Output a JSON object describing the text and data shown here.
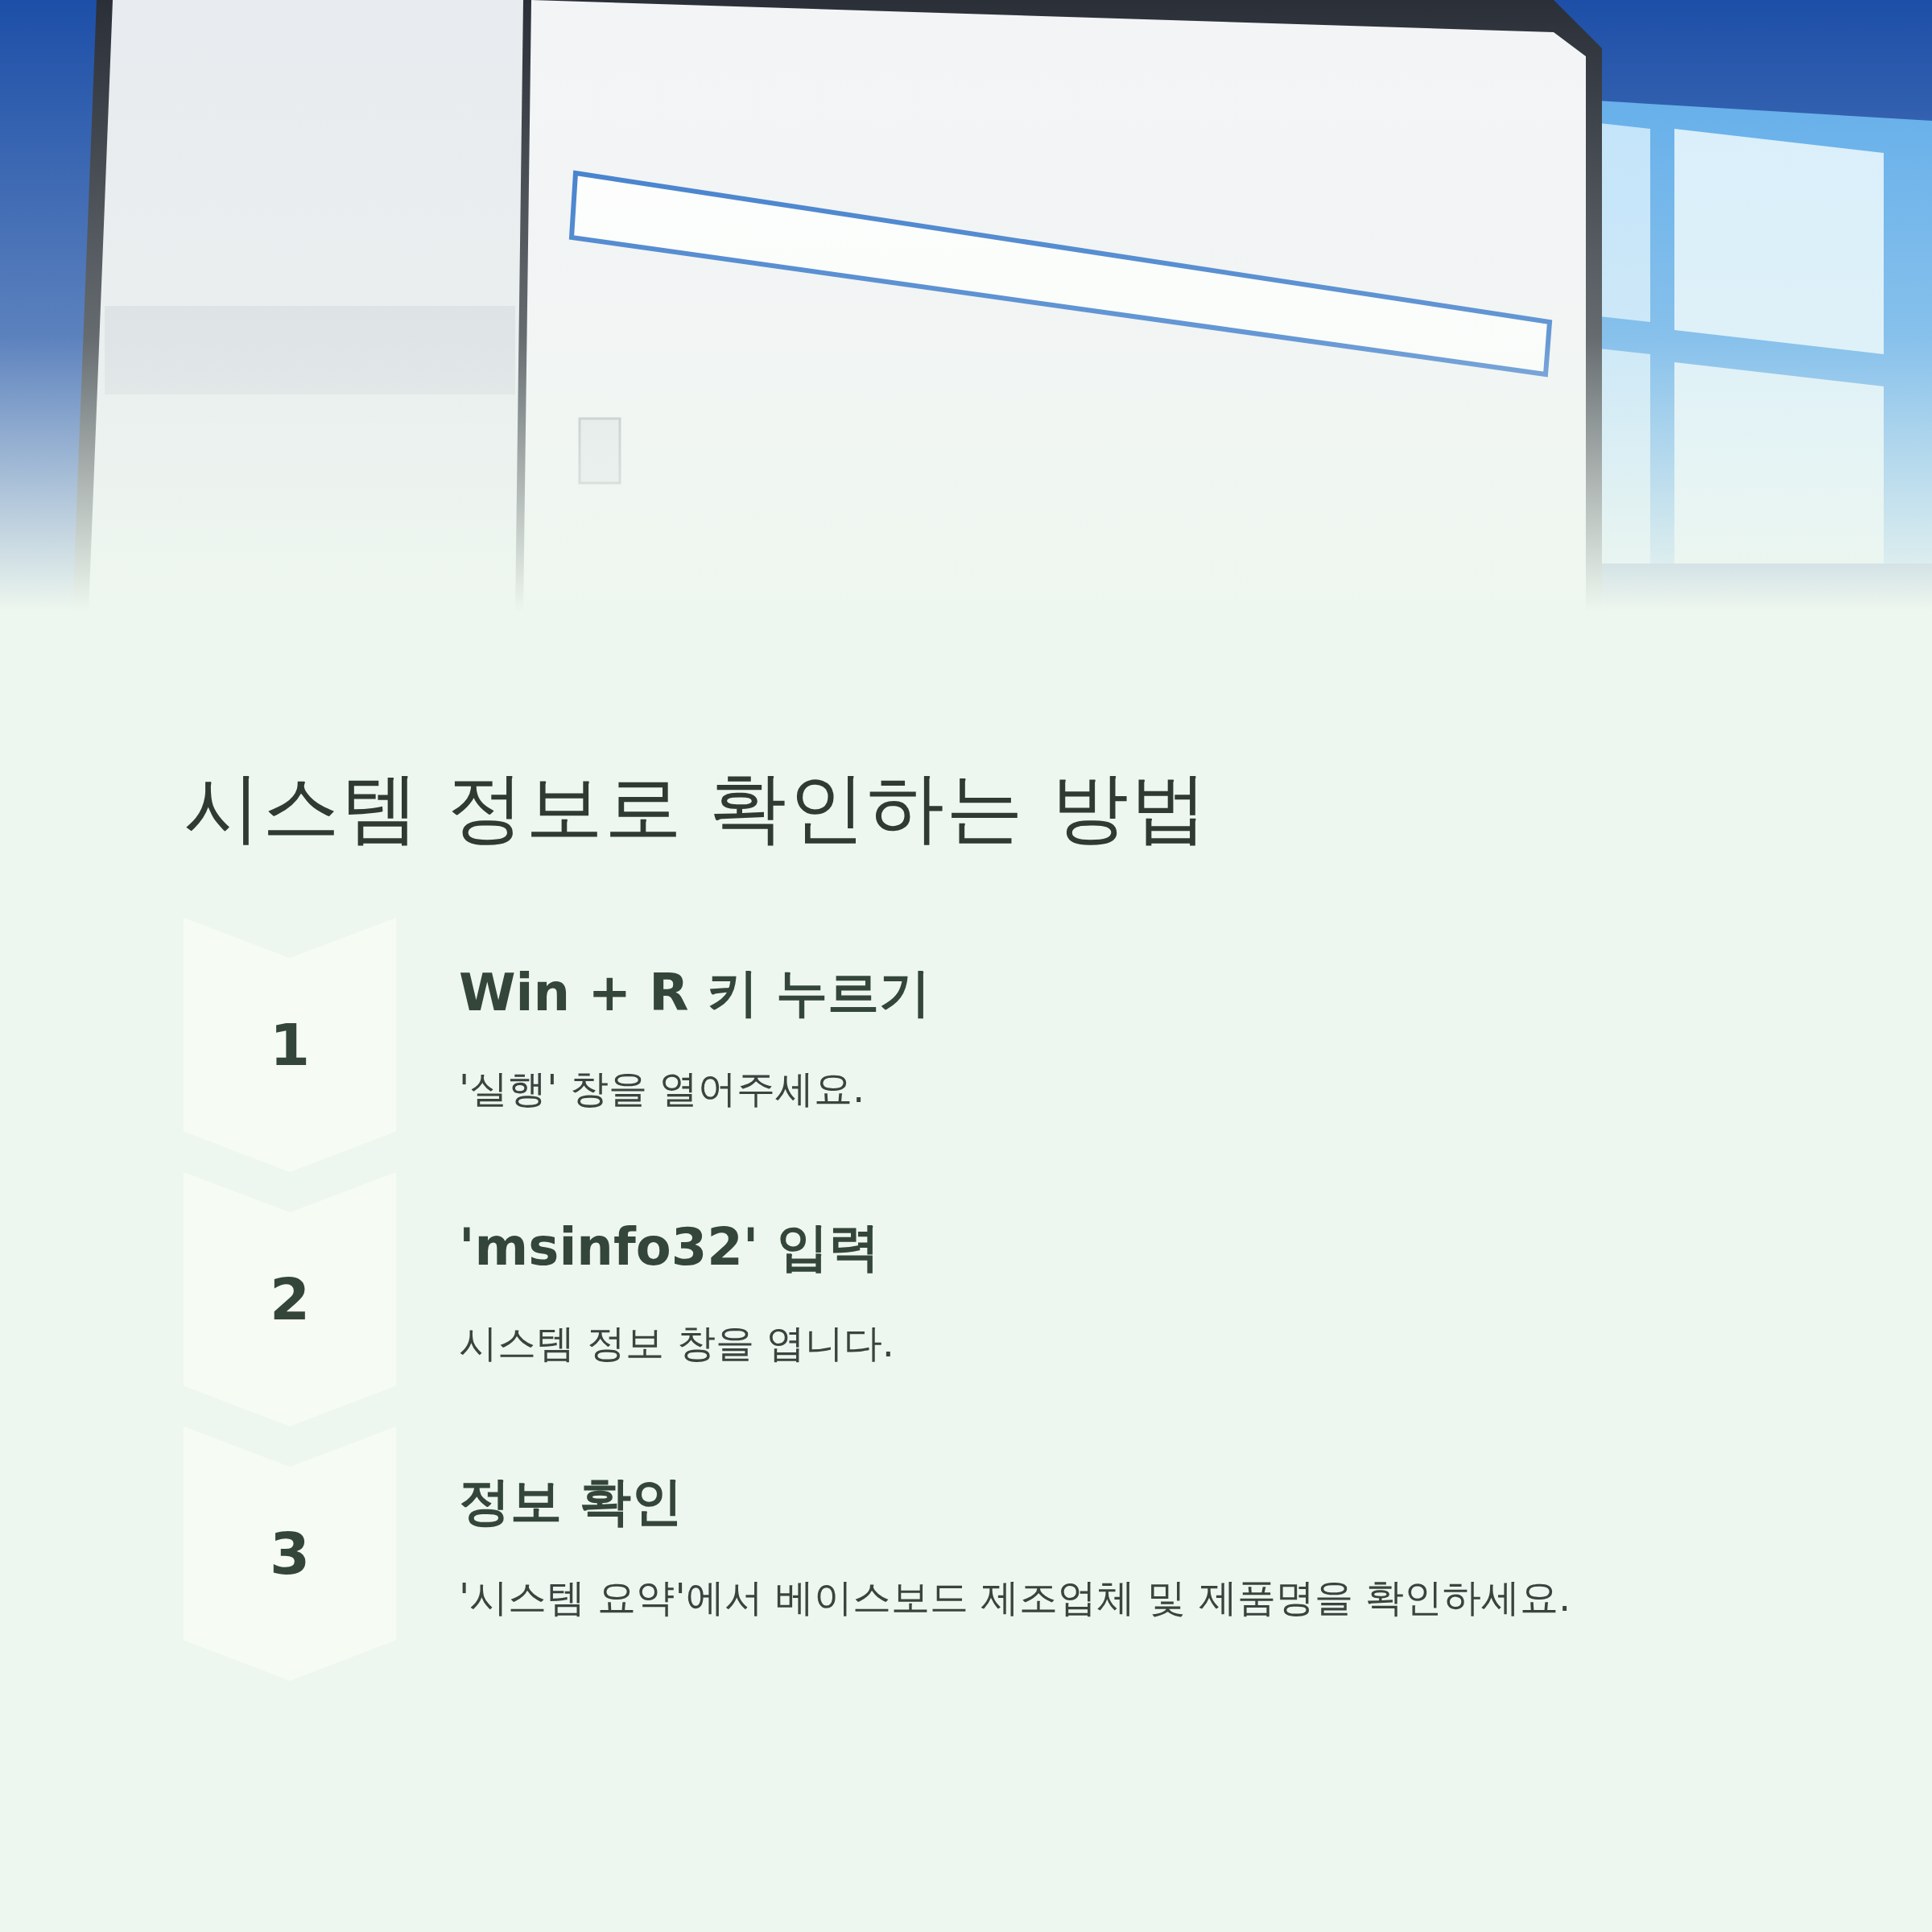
{
  "title": "시스템 정보로 확인하는 방법",
  "steps": [
    {
      "number": "1",
      "heading": "Win + R 키 누르기",
      "description": "'실행' 창을 열어주세요."
    },
    {
      "number": "2",
      "heading": "'msinfo32' 입력",
      "description": "시스템 정보 창을 엽니다."
    },
    {
      "number": "3",
      "heading": "정보 확인",
      "description": "'시스템 요약'에서 베이스보드 제조업체 및 제품명을 확인하세요."
    }
  ]
}
